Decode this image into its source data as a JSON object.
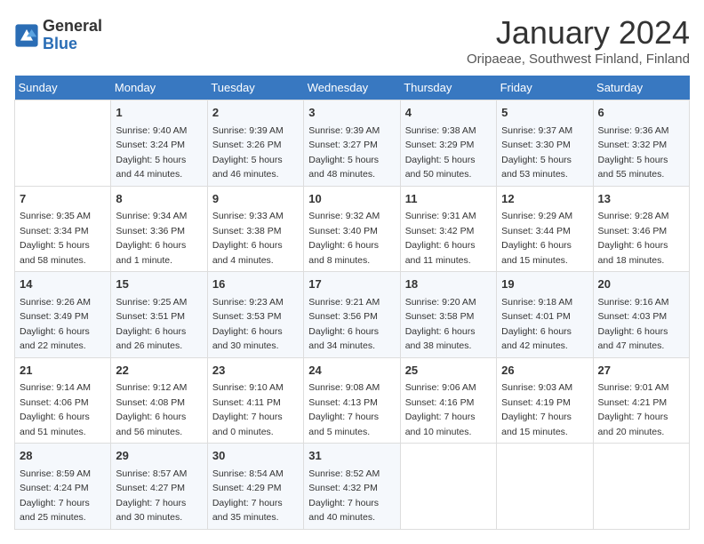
{
  "logo": {
    "general": "General",
    "blue": "Blue"
  },
  "title": "January 2024",
  "subtitle": "Oripaeae, Southwest Finland, Finland",
  "days_header": [
    "Sunday",
    "Monday",
    "Tuesday",
    "Wednesday",
    "Thursday",
    "Friday",
    "Saturday"
  ],
  "weeks": [
    [
      {
        "day": "",
        "sunrise": "",
        "sunset": "",
        "daylight": ""
      },
      {
        "day": "1",
        "sunrise": "Sunrise: 9:40 AM",
        "sunset": "Sunset: 3:24 PM",
        "daylight": "Daylight: 5 hours and 44 minutes."
      },
      {
        "day": "2",
        "sunrise": "Sunrise: 9:39 AM",
        "sunset": "Sunset: 3:26 PM",
        "daylight": "Daylight: 5 hours and 46 minutes."
      },
      {
        "day": "3",
        "sunrise": "Sunrise: 9:39 AM",
        "sunset": "Sunset: 3:27 PM",
        "daylight": "Daylight: 5 hours and 48 minutes."
      },
      {
        "day": "4",
        "sunrise": "Sunrise: 9:38 AM",
        "sunset": "Sunset: 3:29 PM",
        "daylight": "Daylight: 5 hours and 50 minutes."
      },
      {
        "day": "5",
        "sunrise": "Sunrise: 9:37 AM",
        "sunset": "Sunset: 3:30 PM",
        "daylight": "Daylight: 5 hours and 53 minutes."
      },
      {
        "day": "6",
        "sunrise": "Sunrise: 9:36 AM",
        "sunset": "Sunset: 3:32 PM",
        "daylight": "Daylight: 5 hours and 55 minutes."
      }
    ],
    [
      {
        "day": "7",
        "sunrise": "Sunrise: 9:35 AM",
        "sunset": "Sunset: 3:34 PM",
        "daylight": "Daylight: 5 hours and 58 minutes."
      },
      {
        "day": "8",
        "sunrise": "Sunrise: 9:34 AM",
        "sunset": "Sunset: 3:36 PM",
        "daylight": "Daylight: 6 hours and 1 minute."
      },
      {
        "day": "9",
        "sunrise": "Sunrise: 9:33 AM",
        "sunset": "Sunset: 3:38 PM",
        "daylight": "Daylight: 6 hours and 4 minutes."
      },
      {
        "day": "10",
        "sunrise": "Sunrise: 9:32 AM",
        "sunset": "Sunset: 3:40 PM",
        "daylight": "Daylight: 6 hours and 8 minutes."
      },
      {
        "day": "11",
        "sunrise": "Sunrise: 9:31 AM",
        "sunset": "Sunset: 3:42 PM",
        "daylight": "Daylight: 6 hours and 11 minutes."
      },
      {
        "day": "12",
        "sunrise": "Sunrise: 9:29 AM",
        "sunset": "Sunset: 3:44 PM",
        "daylight": "Daylight: 6 hours and 15 minutes."
      },
      {
        "day": "13",
        "sunrise": "Sunrise: 9:28 AM",
        "sunset": "Sunset: 3:46 PM",
        "daylight": "Daylight: 6 hours and 18 minutes."
      }
    ],
    [
      {
        "day": "14",
        "sunrise": "Sunrise: 9:26 AM",
        "sunset": "Sunset: 3:49 PM",
        "daylight": "Daylight: 6 hours and 22 minutes."
      },
      {
        "day": "15",
        "sunrise": "Sunrise: 9:25 AM",
        "sunset": "Sunset: 3:51 PM",
        "daylight": "Daylight: 6 hours and 26 minutes."
      },
      {
        "day": "16",
        "sunrise": "Sunrise: 9:23 AM",
        "sunset": "Sunset: 3:53 PM",
        "daylight": "Daylight: 6 hours and 30 minutes."
      },
      {
        "day": "17",
        "sunrise": "Sunrise: 9:21 AM",
        "sunset": "Sunset: 3:56 PM",
        "daylight": "Daylight: 6 hours and 34 minutes."
      },
      {
        "day": "18",
        "sunrise": "Sunrise: 9:20 AM",
        "sunset": "Sunset: 3:58 PM",
        "daylight": "Daylight: 6 hours and 38 minutes."
      },
      {
        "day": "19",
        "sunrise": "Sunrise: 9:18 AM",
        "sunset": "Sunset: 4:01 PM",
        "daylight": "Daylight: 6 hours and 42 minutes."
      },
      {
        "day": "20",
        "sunrise": "Sunrise: 9:16 AM",
        "sunset": "Sunset: 4:03 PM",
        "daylight": "Daylight: 6 hours and 47 minutes."
      }
    ],
    [
      {
        "day": "21",
        "sunrise": "Sunrise: 9:14 AM",
        "sunset": "Sunset: 4:06 PM",
        "daylight": "Daylight: 6 hours and 51 minutes."
      },
      {
        "day": "22",
        "sunrise": "Sunrise: 9:12 AM",
        "sunset": "Sunset: 4:08 PM",
        "daylight": "Daylight: 6 hours and 56 minutes."
      },
      {
        "day": "23",
        "sunrise": "Sunrise: 9:10 AM",
        "sunset": "Sunset: 4:11 PM",
        "daylight": "Daylight: 7 hours and 0 minutes."
      },
      {
        "day": "24",
        "sunrise": "Sunrise: 9:08 AM",
        "sunset": "Sunset: 4:13 PM",
        "daylight": "Daylight: 7 hours and 5 minutes."
      },
      {
        "day": "25",
        "sunrise": "Sunrise: 9:06 AM",
        "sunset": "Sunset: 4:16 PM",
        "daylight": "Daylight: 7 hours and 10 minutes."
      },
      {
        "day": "26",
        "sunrise": "Sunrise: 9:03 AM",
        "sunset": "Sunset: 4:19 PM",
        "daylight": "Daylight: 7 hours and 15 minutes."
      },
      {
        "day": "27",
        "sunrise": "Sunrise: 9:01 AM",
        "sunset": "Sunset: 4:21 PM",
        "daylight": "Daylight: 7 hours and 20 minutes."
      }
    ],
    [
      {
        "day": "28",
        "sunrise": "Sunrise: 8:59 AM",
        "sunset": "Sunset: 4:24 PM",
        "daylight": "Daylight: 7 hours and 25 minutes."
      },
      {
        "day": "29",
        "sunrise": "Sunrise: 8:57 AM",
        "sunset": "Sunset: 4:27 PM",
        "daylight": "Daylight: 7 hours and 30 minutes."
      },
      {
        "day": "30",
        "sunrise": "Sunrise: 8:54 AM",
        "sunset": "Sunset: 4:29 PM",
        "daylight": "Daylight: 7 hours and 35 minutes."
      },
      {
        "day": "31",
        "sunrise": "Sunrise: 8:52 AM",
        "sunset": "Sunset: 4:32 PM",
        "daylight": "Daylight: 7 hours and 40 minutes."
      },
      {
        "day": "",
        "sunrise": "",
        "sunset": "",
        "daylight": ""
      },
      {
        "day": "",
        "sunrise": "",
        "sunset": "",
        "daylight": ""
      },
      {
        "day": "",
        "sunrise": "",
        "sunset": "",
        "daylight": ""
      }
    ]
  ]
}
